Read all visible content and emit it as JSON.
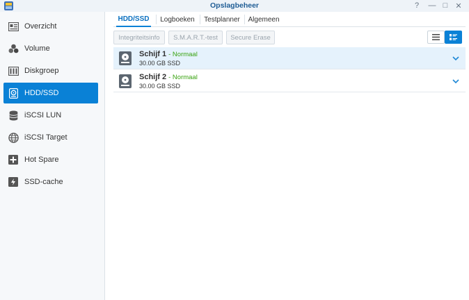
{
  "window": {
    "title": "Opslagbeheer",
    "controls": {
      "help": "?",
      "minimize": "—",
      "maximize": "□",
      "close": "✕"
    }
  },
  "sidebar": {
    "items": [
      {
        "label": "Overzicht",
        "icon": "overview-icon",
        "active": false
      },
      {
        "label": "Volume",
        "icon": "volume-icon",
        "active": false
      },
      {
        "label": "Diskgroep",
        "icon": "diskgroup-icon",
        "active": false
      },
      {
        "label": "HDD/SSD",
        "icon": "hdd-icon",
        "active": true
      },
      {
        "label": "iSCSI LUN",
        "icon": "database-icon",
        "active": false
      },
      {
        "label": "iSCSI Target",
        "icon": "globe-icon",
        "active": false
      },
      {
        "label": "Hot Spare",
        "icon": "hot-spare-icon",
        "active": false
      },
      {
        "label": "SSD-cache",
        "icon": "ssd-cache-icon",
        "active": false
      }
    ]
  },
  "tabs": [
    {
      "label": "HDD/SSD",
      "active": true
    },
    {
      "label": "Logboeken",
      "active": false
    },
    {
      "label": "Testplanner",
      "active": false
    },
    {
      "label": "Algemeen",
      "active": false
    }
  ],
  "toolbar": {
    "integrity_label": "Integriteitsinfo",
    "smart_label": "S.M.A.R.T.-test",
    "erase_label": "Secure Erase",
    "view_list": "list-view-icon",
    "view_detail": "detail-view-icon"
  },
  "disks": [
    {
      "name": "Schijf 1",
      "status": "- Normaal",
      "size": "30.00 GB SSD",
      "selected": true
    },
    {
      "name": "Schijf 2",
      "status": "- Normaal",
      "size": "30.00 GB SSD",
      "selected": false
    }
  ],
  "colors": {
    "accent": "#0a81d6",
    "status_ok": "#3aa312",
    "selected_row": "#e5f2fc"
  }
}
